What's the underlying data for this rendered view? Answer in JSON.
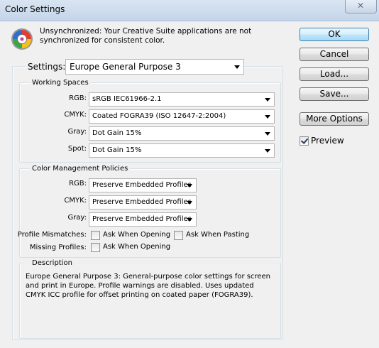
{
  "window": {
    "title": "Color Settings",
    "close_glyph": "✕"
  },
  "info": {
    "icon": "color-wheel-icon",
    "text": "Unsynchronized: Your Creative Suite applications are not synchronized for consistent color."
  },
  "settings": {
    "label": "Settings:",
    "value": "Europe General Purpose 3"
  },
  "working_spaces": {
    "title": "Working Spaces",
    "rgb": {
      "label": "RGB:",
      "value": "sRGB IEC61966-2.1"
    },
    "cmyk": {
      "label": "CMYK:",
      "value": "Coated FOGRA39 (ISO 12647-2:2004)"
    },
    "gray": {
      "label": "Gray:",
      "value": "Dot Gain 15%"
    },
    "spot": {
      "label": "Spot:",
      "value": "Dot Gain 15%"
    }
  },
  "policies": {
    "title": "Color Management Policies",
    "rgb": {
      "label": "RGB:",
      "value": "Preserve Embedded Profiles"
    },
    "cmyk": {
      "label": "CMYK:",
      "value": "Preserve Embedded Profiles"
    },
    "gray": {
      "label": "Gray:",
      "value": "Preserve Embedded Profiles"
    },
    "mismatches": {
      "label": "Profile Mismatches:",
      "ask_opening": {
        "label": "Ask When Opening",
        "checked": false
      },
      "ask_pasting": {
        "label": "Ask When Pasting",
        "checked": false
      }
    },
    "missing": {
      "label": "Missing Profiles:",
      "ask_opening": {
        "label": "Ask When Opening",
        "checked": false
      }
    }
  },
  "description": {
    "title": "Description",
    "text": "Europe General Purpose 3:  General-purpose color settings for screen and print in Europe. Profile warnings are disabled. Uses updated CMYK ICC profile for offset printing on coated paper (FOGRA39)."
  },
  "buttons": {
    "ok": "OK",
    "cancel": "Cancel",
    "load": "Load...",
    "save": "Save...",
    "more_options": "More Options"
  },
  "preview": {
    "label": "Preview",
    "checked": true
  }
}
